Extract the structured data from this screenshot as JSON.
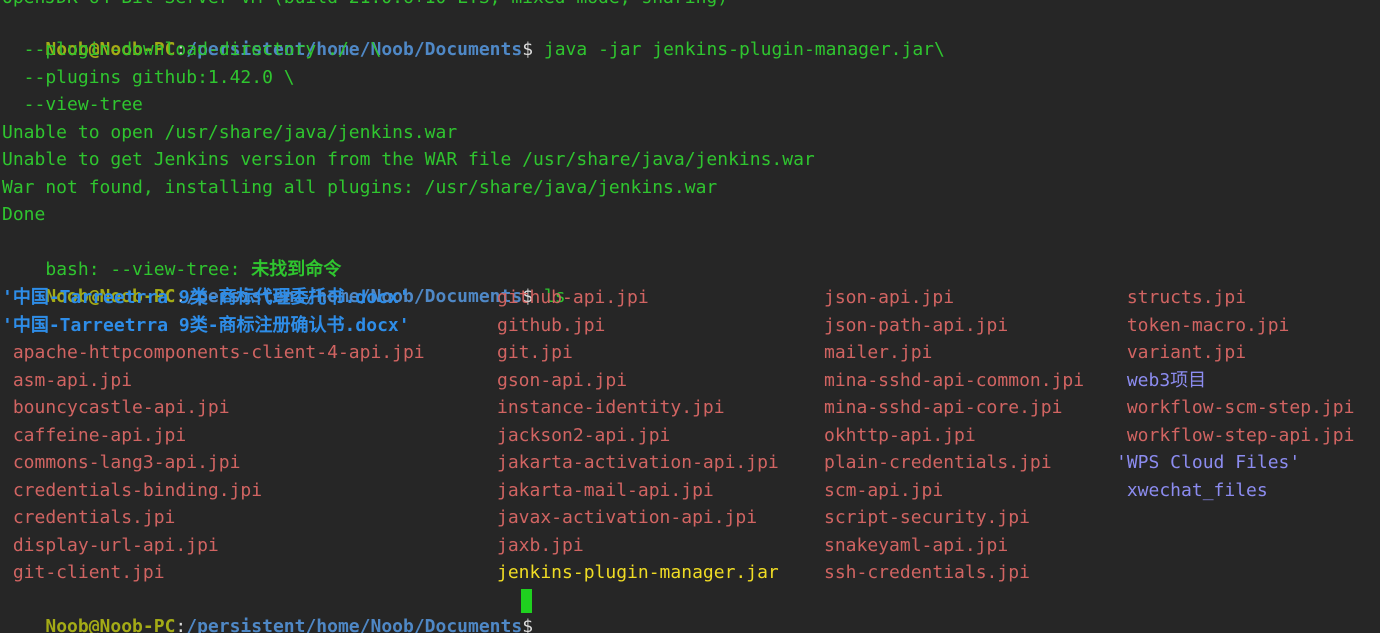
{
  "terminal": {
    "top_cut_line": "OpenJDK 64-Bit Server VM (build 21.0.6+10-LTS, mixed mode, sharing)",
    "prompt": {
      "user_host": "Noob@Noob-PC",
      "colon": ":",
      "path": "/persistent/home/Noob/Documents",
      "dollar": "$"
    },
    "cmd1": {
      "line1": " java -jar jenkins-plugin-manager.jar\\",
      "line2": "  --plugin-download-directory ./  \\",
      "line3": "  --plugins github:1.42.0 \\",
      "line4": "  --view-tree"
    },
    "output": [
      "Unable to open /usr/share/java/jenkins.war",
      "Unable to get Jenkins version from the WAR file /usr/share/java/jenkins.war",
      "War not found, installing all plugins: /usr/share/java/jenkins.war",
      "Done"
    ],
    "bash_error": {
      "prefix": "bash: --view-tree: ",
      "message": "未找到命令"
    },
    "cmd2": " ls",
    "ls_columns": [
      [
        {
          "name": "'中国-Tarreetrra 9类-商标代理委托书.docx'",
          "kind": "quoted"
        },
        {
          "name": "'中国-Tarreetrra 9类-商标注册确认书.docx'",
          "kind": "quoted"
        },
        {
          "name": " apache-httpcomponents-client-4-api.jpi",
          "kind": "file"
        },
        {
          "name": " asm-api.jpi",
          "kind": "file"
        },
        {
          "name": " bouncycastle-api.jpi",
          "kind": "file"
        },
        {
          "name": " caffeine-api.jpi",
          "kind": "file"
        },
        {
          "name": " commons-lang3-api.jpi",
          "kind": "file"
        },
        {
          "name": " credentials-binding.jpi",
          "kind": "file"
        },
        {
          "name": " credentials.jpi",
          "kind": "file"
        },
        {
          "name": " display-url-api.jpi",
          "kind": "file"
        },
        {
          "name": " git-client.jpi",
          "kind": "file"
        }
      ],
      [
        {
          "name": "github-api.jpi",
          "kind": "file"
        },
        {
          "name": "github.jpi",
          "kind": "file"
        },
        {
          "name": "git.jpi",
          "kind": "file"
        },
        {
          "name": "gson-api.jpi",
          "kind": "file"
        },
        {
          "name": "instance-identity.jpi",
          "kind": "file"
        },
        {
          "name": "jackson2-api.jpi",
          "kind": "file"
        },
        {
          "name": "jakarta-activation-api.jpi",
          "kind": "file"
        },
        {
          "name": "jakarta-mail-api.jpi",
          "kind": "file"
        },
        {
          "name": "javax-activation-api.jpi",
          "kind": "file"
        },
        {
          "name": "jaxb.jpi",
          "kind": "file"
        },
        {
          "name": "jenkins-plugin-manager.jar",
          "kind": "exec"
        }
      ],
      [
        {
          "name": "json-api.jpi",
          "kind": "file"
        },
        {
          "name": "json-path-api.jpi",
          "kind": "file"
        },
        {
          "name": "mailer.jpi",
          "kind": "file"
        },
        {
          "name": "mina-sshd-api-common.jpi",
          "kind": "file"
        },
        {
          "name": "mina-sshd-api-core.jpi",
          "kind": "file"
        },
        {
          "name": "okhttp-api.jpi",
          "kind": "file"
        },
        {
          "name": "plain-credentials.jpi",
          "kind": "file"
        },
        {
          "name": "scm-api.jpi",
          "kind": "file"
        },
        {
          "name": "script-security.jpi",
          "kind": "file"
        },
        {
          "name": "snakeyaml-api.jpi",
          "kind": "file"
        },
        {
          "name": "ssh-credentials.jpi",
          "kind": "file"
        }
      ],
      [
        {
          "name": " structs.jpi",
          "kind": "file"
        },
        {
          "name": " token-macro.jpi",
          "kind": "file"
        },
        {
          "name": " variant.jpi",
          "kind": "file"
        },
        {
          "name": " web3项目",
          "kind": "dir"
        },
        {
          "name": " workflow-scm-step.jpi",
          "kind": "file"
        },
        {
          "name": " workflow-step-api.jpi",
          "kind": "file"
        },
        {
          "name": "'WPS Cloud Files'",
          "kind": "dir"
        },
        {
          "name": " xwechat_files",
          "kind": "dir"
        }
      ]
    ]
  }
}
